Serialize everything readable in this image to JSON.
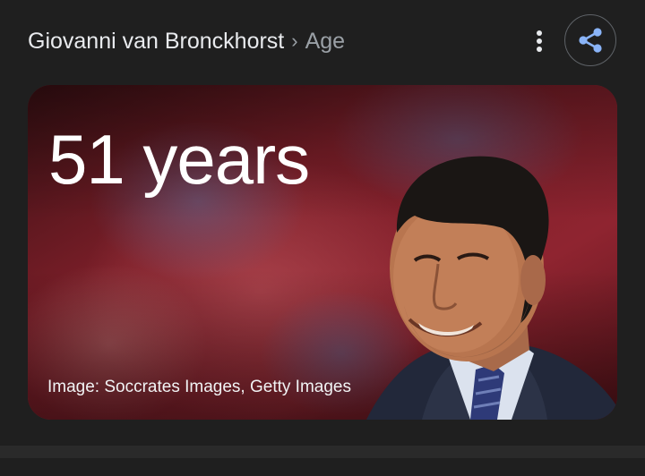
{
  "header": {
    "title": "Giovanni van Bronckhorst",
    "separator": "›",
    "subtitle": "Age",
    "more_icon": "more-vert-icon",
    "share_icon": "share-icon"
  },
  "card": {
    "value": "51 years",
    "credit": "Image: Soccrates Images, Getty Images",
    "image_subject": "portrait-photo"
  },
  "colors": {
    "background": "#1f1f1f",
    "text_primary": "#e8eaed",
    "text_secondary": "#9aa0a6",
    "share_accent": "#8ab4f8",
    "card_bg": "#6a1d24"
  }
}
